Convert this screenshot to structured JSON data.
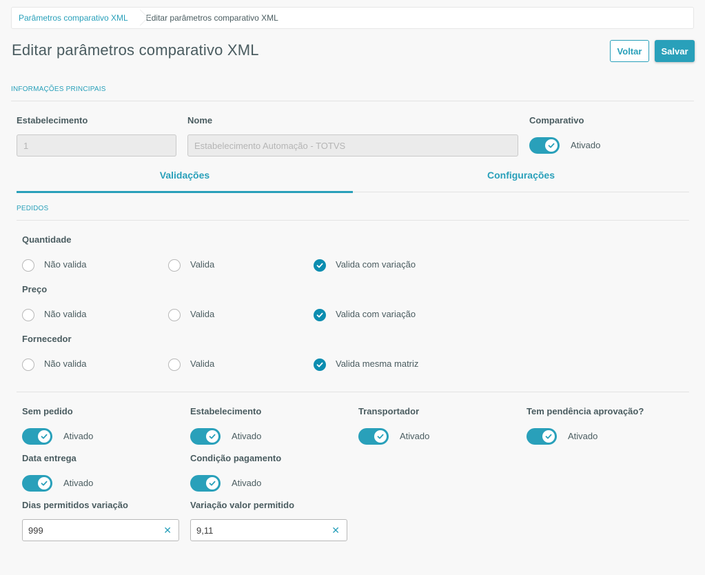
{
  "breadcrumb": {
    "link": "Parâmetros comparativo XML",
    "current": "Editar parâmetros comparativo XML"
  },
  "header": {
    "title": "Editar parâmetros comparativo XML",
    "back_label": "Voltar",
    "save_label": "Salvar"
  },
  "main_info": {
    "section_title": "INFORMAÇÕES PRINCIPAIS",
    "establishment_label": "Estabelecimento",
    "establishment_value": "1",
    "name_label": "Nome",
    "name_value": "Estabelecimento Automação - TOTVS",
    "comparative_label": "Comparativo",
    "comparative_state": "Ativado",
    "comparative_on": true
  },
  "tabs": [
    {
      "label": "Validações",
      "active": true
    },
    {
      "label": "Configurações",
      "active": false
    }
  ],
  "orders": {
    "section_title": "PEDIDOS",
    "groups": [
      {
        "label": "Quantidade",
        "options": [
          "Não valida",
          "Valida",
          "Valida com variação"
        ],
        "selected": 2
      },
      {
        "label": "Preço",
        "options": [
          "Não valida",
          "Valida",
          "Valida com variação"
        ],
        "selected": 2
      },
      {
        "label": "Fornecedor",
        "options": [
          "Não valida",
          "Valida",
          "Valida mesma matriz"
        ],
        "selected": 2
      }
    ]
  },
  "switches": [
    {
      "label": "Sem pedido",
      "state": "Ativado",
      "on": true
    },
    {
      "label": "Estabelecimento",
      "state": "Ativado",
      "on": true
    },
    {
      "label": "Transportador",
      "state": "Ativado",
      "on": true
    },
    {
      "label": "Tem pendência aprovação?",
      "state": "Ativado",
      "on": true
    },
    {
      "label": "Data entrega",
      "state": "Ativado",
      "on": true
    },
    {
      "label": "Condição pagamento",
      "state": "Ativado",
      "on": true
    }
  ],
  "variation": {
    "days_label": "Dias permitidos variação",
    "days_value": "999",
    "value_label": "Variação valor permitido",
    "value_value": "9,11"
  },
  "colors": {
    "primary": "#29a0ba",
    "radio_checked": "#0c8db0",
    "text": "#4a5c60",
    "background": "#f8f8f8"
  }
}
